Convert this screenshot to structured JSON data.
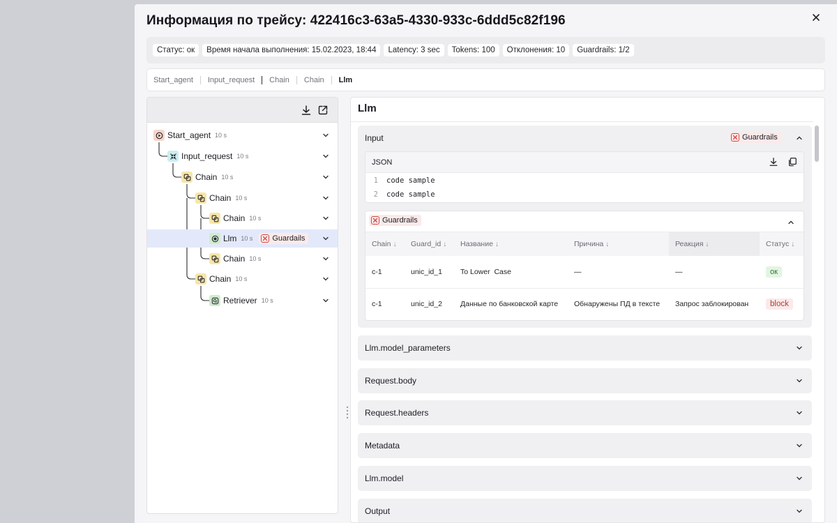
{
  "modal": {
    "title": "Информация по трейсу: 422416c3-63a5-4330-933c-6ddd5c82f196"
  },
  "info_chips": [
    "Статус: ок",
    "Время начала выполнения: 15.02.2023, 18:44",
    "Latency: 3 sec",
    "Tokens: 100",
    "Отклонения: 10",
    "Guardrails: 1/2"
  ],
  "breadcrumbs": [
    "Start_agent",
    "Input_request",
    "Chain",
    "Chain",
    "Llm"
  ],
  "tree": {
    "nodes": [
      {
        "label": "Start_agent",
        "time": "10 s",
        "icon": "play-icon",
        "color": "#f6d6c9"
      },
      {
        "label": "Input_request",
        "time": "10 s",
        "icon": "arrows-icon",
        "color": "#cdeef0"
      },
      {
        "label": "Chain",
        "time": "10 s",
        "icon": "chain-icon",
        "color": "#f8e6a8"
      },
      {
        "label": "Chain",
        "time": "10 s",
        "icon": "chain-icon",
        "color": "#f8e6a8"
      },
      {
        "label": "Chain",
        "time": "10 s",
        "icon": "chain-icon",
        "color": "#f8e6a8"
      },
      {
        "label": "Llm",
        "time": "10 s",
        "icon": "llm-icon",
        "color": "#cfeccf",
        "guard": "Guardails",
        "selected": true
      },
      {
        "label": "Chain",
        "time": "10 s",
        "icon": "chain-icon",
        "color": "#f8e6a8"
      },
      {
        "label": "Chain",
        "time": "10 s",
        "icon": "chain-icon",
        "color": "#f8e6a8"
      },
      {
        "label": "Retriever",
        "time": "10 s",
        "icon": "retriever-icon",
        "color": "#cfeccf"
      }
    ]
  },
  "right": {
    "title": "Llm",
    "input_label": "Input",
    "guard_label": "Guardrails",
    "json_label": "JSON",
    "code_lines": [
      {
        "num": "1",
        "text": "code sample"
      },
      {
        "num": "2",
        "text": "code sample"
      }
    ],
    "table": {
      "headers": [
        "Chain",
        "Guard_id",
        "Название",
        "Причина",
        "Реакция",
        "Статус"
      ],
      "rows": [
        {
          "chain": "c-1",
          "guard_id": "unic_id_1",
          "name": "To Lower  Case",
          "reason": "—",
          "reaction": "—",
          "status": "ок"
        },
        {
          "chain": "c-1",
          "guard_id": "unic_id_2",
          "name": "Данные по банковской карте",
          "reason": "Обнаружены ПД в тексте",
          "reaction": "Запрос заблокирован",
          "status": "block"
        }
      ]
    },
    "sections": [
      "Llm.model_parameters",
      "Request.body",
      "Request.headers",
      "Metadata",
      "Llm.model",
      "Output"
    ]
  },
  "colors": {
    "danger": "#d24a43",
    "selected_row": "#e3e9fb"
  }
}
